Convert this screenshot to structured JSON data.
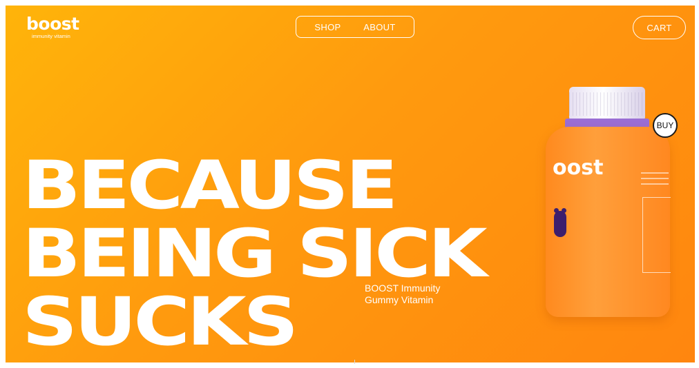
{
  "brand": {
    "name": "boost",
    "tagline": "immunity vitamin"
  },
  "nav": {
    "items": [
      {
        "label": "SHOP"
      },
      {
        "label": "ABOUT"
      }
    ]
  },
  "cart": {
    "label": "CART"
  },
  "hero": {
    "headline": [
      "BECAUSE",
      "BEING SICK",
      "SUCKS"
    ],
    "subtitle": [
      "BOOST Immunity",
      "Gummy Vitamin"
    ]
  },
  "product": {
    "brand_on_bottle": "oost",
    "buy_label": "BUY"
  },
  "colors": {
    "gradient_start": "#ffb40a",
    "gradient_end": "#ff860f",
    "text": "#ffffff"
  }
}
